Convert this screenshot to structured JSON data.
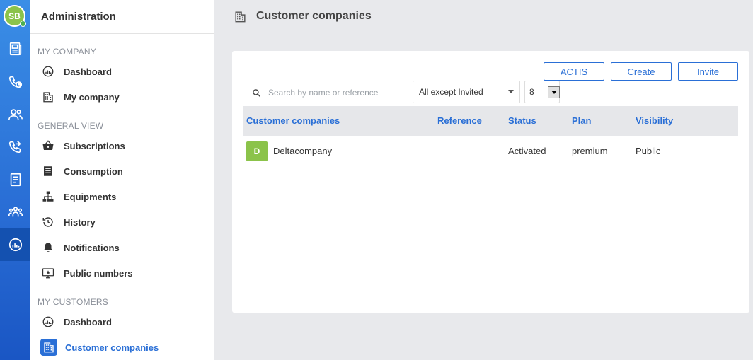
{
  "user": {
    "initials": "SB"
  },
  "sidenav": {
    "title": "Administration",
    "sections": {
      "my_company": {
        "title": "MY COMPANY",
        "items": [
          {
            "label": "Dashboard",
            "icon": "dashboard-gauge-icon"
          },
          {
            "label": "My company",
            "icon": "building-icon"
          }
        ]
      },
      "general_view": {
        "title": "GENERAL VIEW",
        "items": [
          {
            "label": "Subscriptions",
            "icon": "basket-icon"
          },
          {
            "label": "Consumption",
            "icon": "invoice-icon"
          },
          {
            "label": "Equipments",
            "icon": "network-tree-icon"
          },
          {
            "label": "History",
            "icon": "history-icon"
          },
          {
            "label": "Notifications",
            "icon": "bell-icon"
          },
          {
            "label": "Public numbers",
            "icon": "monitor-star-icon"
          }
        ]
      },
      "my_customers": {
        "title": "MY CUSTOMERS",
        "items": [
          {
            "label": "Dashboard",
            "icon": "dashboard-gauge-icon"
          },
          {
            "label": "Customer companies",
            "icon": "building-icon",
            "active": true
          }
        ]
      }
    }
  },
  "main": {
    "title": "Customer companies",
    "buttons": {
      "actis": "ACTIS",
      "create": "Create",
      "invite": "Invite"
    },
    "search": {
      "placeholder": "Search by name or reference",
      "value": ""
    },
    "filter": {
      "selected": "All except Invited"
    },
    "page_size": {
      "selected": "8"
    },
    "table": {
      "columns": [
        "Customer companies",
        "Reference",
        "Status",
        "Plan",
        "Visibility"
      ],
      "rows": [
        {
          "initial": "D",
          "name": "Deltacompany",
          "reference": "",
          "status": "Activated",
          "plan": "premium",
          "visibility": "Public"
        }
      ]
    }
  },
  "colors": {
    "accent": "#2a6fd6",
    "rail_top": "#3a8ee6",
    "rail_bottom": "#1a56c4",
    "badge_green": "#8bc34a"
  }
}
